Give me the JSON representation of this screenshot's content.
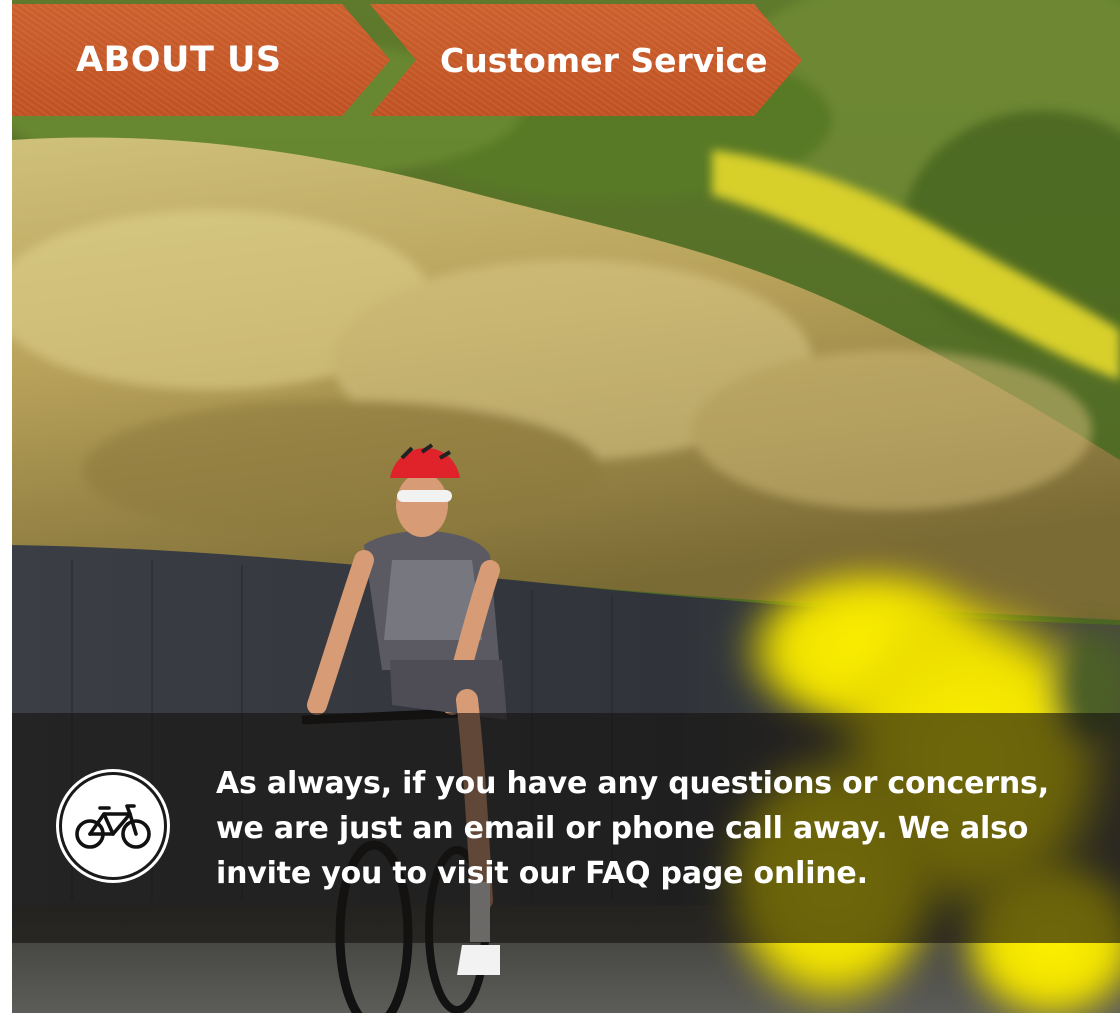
{
  "breadcrumb": {
    "items": [
      {
        "label": "ABOUT US"
      },
      {
        "label": "Customer Service"
      }
    ],
    "color": "#c95a2b"
  },
  "hero": {
    "image": "cyclist-on-hillside-road-photo",
    "accent_yellow": "#f2e200"
  },
  "info_panel": {
    "icon": "bicycle-icon",
    "message": "As always, if you have any questions or concerns, we are just an email or phone call away. We also invite you to visit our FAQ page online."
  }
}
